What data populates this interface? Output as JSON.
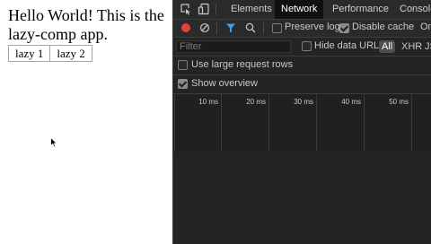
{
  "app": {
    "heading": "Hello World! This is the lazy-comp app.",
    "buttons": [
      "lazy 1",
      "lazy 2"
    ]
  },
  "devtools": {
    "tabs": {
      "elements": "Elements",
      "network": "Network",
      "performance": "Performance",
      "console": "Console"
    },
    "toolbar": {
      "preserve_log": "Preserve log",
      "preserve_log_checked": false,
      "disable_cache": "Disable cache",
      "disable_cache_checked": true,
      "online": "Online"
    },
    "filter": {
      "placeholder": "Filter",
      "hide_data_urls": "Hide data URLs",
      "hide_data_urls_checked": false,
      "types": [
        "All",
        "XHR",
        "JS"
      ],
      "active_type": "All"
    },
    "options": {
      "large_rows": "Use large request rows",
      "large_rows_checked": false,
      "show_overview": "Show overview",
      "show_overview_checked": true
    },
    "timeline": {
      "ticks": [
        "10 ms",
        "20 ms",
        "30 ms",
        "40 ms",
        "50 ms"
      ]
    }
  },
  "colors": {
    "record": "#e0433a",
    "filter_active": "#4a9ce0",
    "devtools_bg": "#242424"
  }
}
